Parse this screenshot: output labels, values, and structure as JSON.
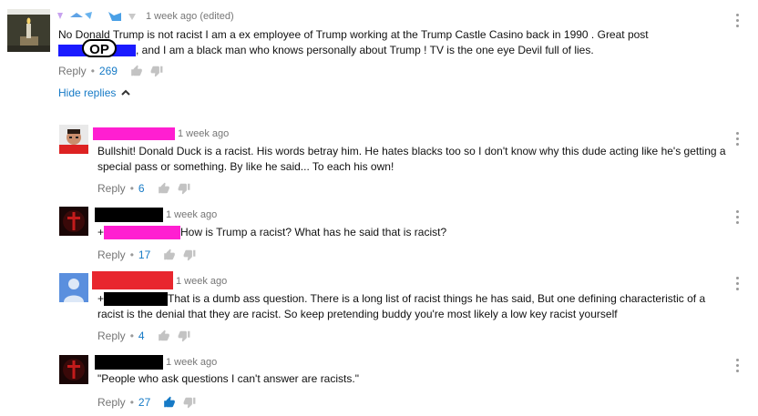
{
  "colors": {
    "accent": "#167ac6",
    "muted": "#767676",
    "magenta": "#ff1fd1",
    "red": "#e8262e",
    "black": "#000000",
    "blue": "#1a1aff"
  },
  "top_comment": {
    "time": "1 week ago (edited)",
    "text_line1": "No Donald Trump is not racist I am a ex employee of Trump working at the Trump Castle Casino back in 1990 . Great post",
    "op_label": "OP",
    "text_line2": ", and I am a black man who knows personally about Trump ! TV is the one eye Devil full of lies.",
    "reply_label": "Reply",
    "likes": "269",
    "hide_replies_label": "Hide replies"
  },
  "replies": [
    {
      "time": "1 week ago",
      "text": "Bullshit! Donald Duck is a racist. His words betray him. He hates blacks too so I don't know why this dude acting like he's getting a special pass or something. By like he said... To each his own!",
      "reply_label": "Reply",
      "likes": "6"
    },
    {
      "time": "1 week ago",
      "prefix": "+",
      "text": "How is Trump a racist? What has he said that is racist?",
      "reply_label": "Reply",
      "likes": "17"
    },
    {
      "time": "1 week ago",
      "prefix": "+",
      "text": "That is a dumb ass question. There is a long list of racist things he has said, But one defining characteristic of a racist is the denial that they are racist. So keep pretending buddy you're most likely a low key racist yourself",
      "reply_label": "Reply",
      "likes": "4"
    },
    {
      "time": "1 week ago",
      "text": "\"People who ask questions I can't answer are racists.\"",
      "reply_label": "Reply",
      "likes": "27"
    }
  ]
}
